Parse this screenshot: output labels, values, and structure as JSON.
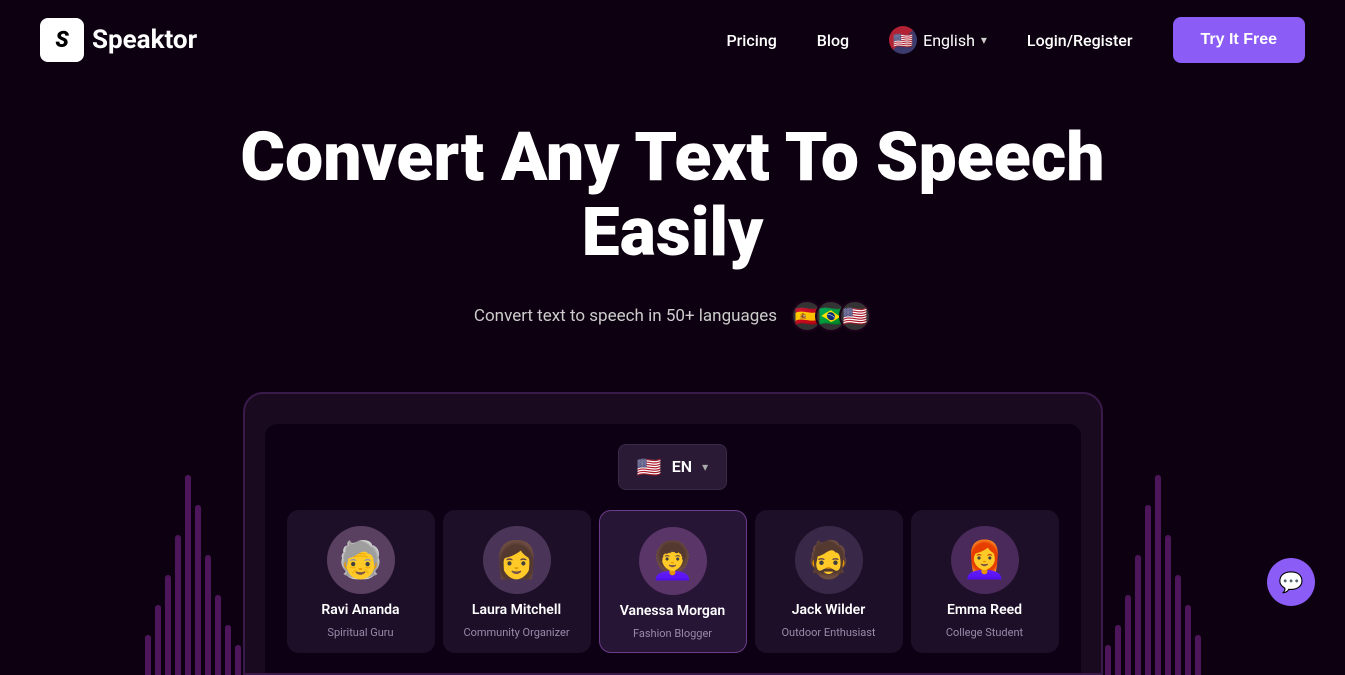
{
  "nav": {
    "logo_text": "Speaktor",
    "links": [
      {
        "label": "Pricing",
        "id": "pricing"
      },
      {
        "label": "Blog",
        "id": "blog"
      }
    ],
    "language": {
      "flag": "🇺🇸",
      "label": "English"
    },
    "auth_label": "Login/Register",
    "cta_label": "Try It Free"
  },
  "hero": {
    "title": "Convert Any Text To Speech Easily",
    "subtitle": "Convert text to speech in 50+ languages",
    "flags": [
      "🇪🇸",
      "🇧🇷",
      "🇺🇸"
    ]
  },
  "laptop": {
    "lang_selector": {
      "flag": "🇺🇸",
      "label": "EN"
    },
    "voices": [
      {
        "name": "Ravi Ananda",
        "role": "Spiritual Guru",
        "emoji": "🧓"
      },
      {
        "name": "Laura Mitchell",
        "role": "Community Organizer",
        "emoji": "👩"
      },
      {
        "name": "Vanessa Morgan",
        "role": "Fashion Blogger",
        "emoji": "👩‍🦱"
      },
      {
        "name": "Jack Wilder",
        "role": "Outdoor Enthusiast",
        "emoji": "🧔"
      },
      {
        "name": "Emma Reed",
        "role": "College Student",
        "emoji": "👩‍🦰"
      }
    ]
  },
  "chat": {
    "icon": "💬"
  }
}
